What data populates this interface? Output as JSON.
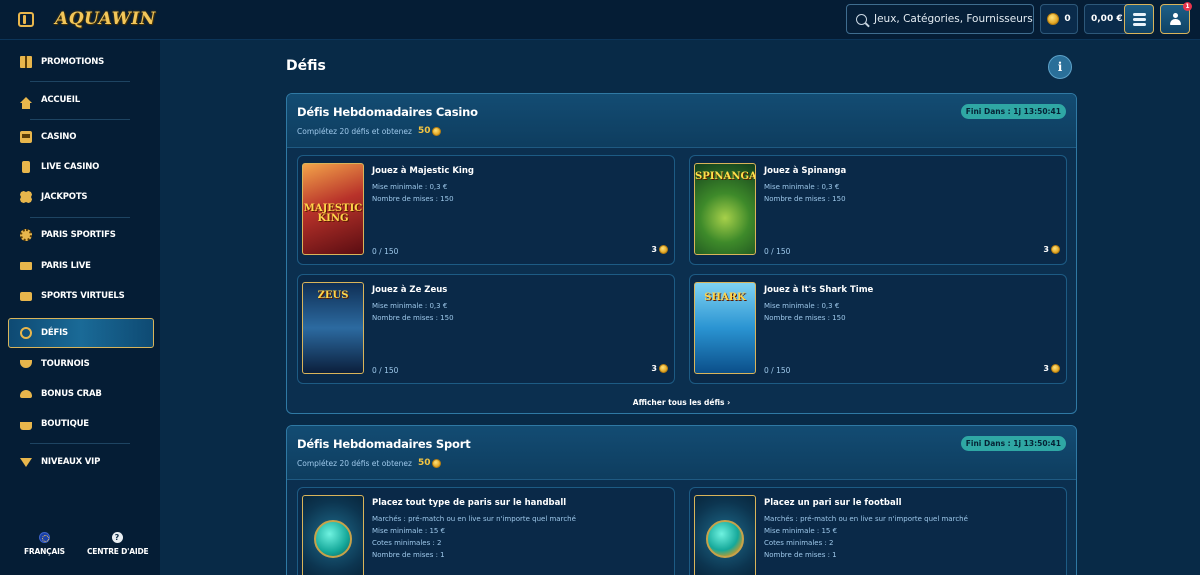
{
  "header": {
    "logo_text": "AQUAWIN",
    "search_placeholder": "Jeux, Catégories, Fournisseurs",
    "coins_value": "0",
    "balance_value": "0,00 €",
    "notification_count": "1"
  },
  "sidebar": {
    "items": [
      {
        "label": "PROMOTIONS",
        "icon": "gift-icon"
      },
      {
        "label": "ACCUEIL",
        "icon": "home-icon"
      },
      {
        "label": "CASINO",
        "icon": "slot-machine-icon"
      },
      {
        "label": "LIVE CASINO",
        "icon": "phone-icon"
      },
      {
        "label": "JACKPOTS",
        "icon": "clover-icon"
      },
      {
        "label": "PARIS SPORTIFS",
        "icon": "sports-ball-icon"
      },
      {
        "label": "PARIS LIVE",
        "icon": "live-icon"
      },
      {
        "label": "SPORTS VIRTUELS",
        "icon": "tv-icon"
      },
      {
        "label": "DÉFIS",
        "icon": "medal-icon"
      },
      {
        "label": "TOURNOIS",
        "icon": "trophy-icon"
      },
      {
        "label": "BONUS CRAB",
        "icon": "crab-icon"
      },
      {
        "label": "BOUTIQUE",
        "icon": "basket-icon"
      },
      {
        "label": "NIVEAUX VIP",
        "icon": "diamond-icon"
      }
    ],
    "footer": {
      "language_label": "FRANÇAIS",
      "help_label": "CENTRE D'AIDE",
      "help_icon_glyph": "?"
    }
  },
  "main": {
    "title": "Défis",
    "info_glyph": "i",
    "casino": {
      "title": "Défis Hebdomadaires Casino",
      "subtitle": "Complétez 20 défis et obtenez",
      "reward": "50",
      "timer": "Fini Dans : 1j 13:50:41",
      "show_all": "Afficher tous les défis ›",
      "cards": [
        {
          "title": "Jouez à Majestic King",
          "thumb_text": "MAJESTIC KING",
          "lines": [
            "Mise minimale : 0,3 €",
            "Nombre de mises : 150"
          ],
          "progress": "0 / 150",
          "reward": "3"
        },
        {
          "title": "Jouez à Spinanga",
          "thumb_text": "SPINANGA",
          "lines": [
            "Mise minimale : 0,3 €",
            "Nombre de mises : 150"
          ],
          "progress": "0 / 150",
          "reward": "3"
        },
        {
          "title": "Jouez à Ze Zeus",
          "thumb_text": "ZEUS",
          "lines": [
            "Mise minimale : 0,3 €",
            "Nombre de mises : 150"
          ],
          "progress": "0 / 150",
          "reward": "3"
        },
        {
          "title": "Jouez à It's Shark Time",
          "thumb_text": "SHARK",
          "lines": [
            "Mise minimale : 0,3 €",
            "Nombre de mises : 150"
          ],
          "progress": "0 / 150",
          "reward": "3"
        }
      ]
    },
    "sport": {
      "title": "Défis Hebdomadaires Sport",
      "subtitle": "Complétez 20 défis et obtenez",
      "reward": "50",
      "timer": "Fini Dans : 1j 13:50:41",
      "cards": [
        {
          "title": "Placez tout type de paris sur le handball",
          "lines": [
            "Marchés : pré-match ou en live sur n'importe quel marché",
            "Mise minimale : 15 €",
            "Cotes minimales : 2",
            "Nombre de mises : 1"
          ]
        },
        {
          "title": "Placez un pari sur le football",
          "lines": [
            "Marchés : pré-match ou en live sur n'importe quel marché",
            "Mise minimale : 15 €",
            "Cotes minimales : 2",
            "Nombre de mises : 1"
          ]
        }
      ]
    }
  }
}
